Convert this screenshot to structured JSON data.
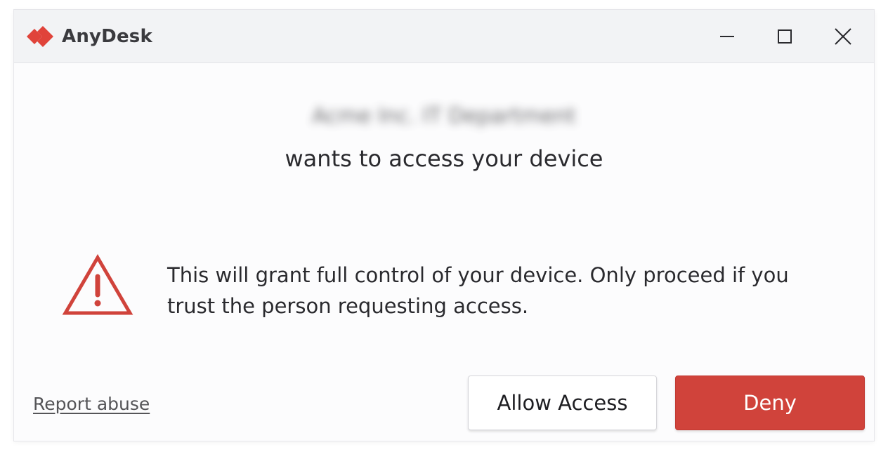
{
  "app": {
    "name": "AnyDesk",
    "logo_icon": "anydesk-logo-icon",
    "brand_color": "#e0433a"
  },
  "titlebar": {
    "minimize_icon": "minimize-icon",
    "maximize_icon": "maximize-icon",
    "close_icon": "close-icon"
  },
  "request": {
    "requester_name": "Acme Inc. IT Department",
    "message": "wants to access your device"
  },
  "warning": {
    "icon": "warning-triangle-icon",
    "icon_color": "#d0433b",
    "text": "This will grant full control of your device. Only proceed if you trust the person requesting access."
  },
  "footer": {
    "report_link": "Report abuse",
    "allow_label": "Allow Access",
    "deny_label": "Deny",
    "deny_color": "#d0433b"
  }
}
